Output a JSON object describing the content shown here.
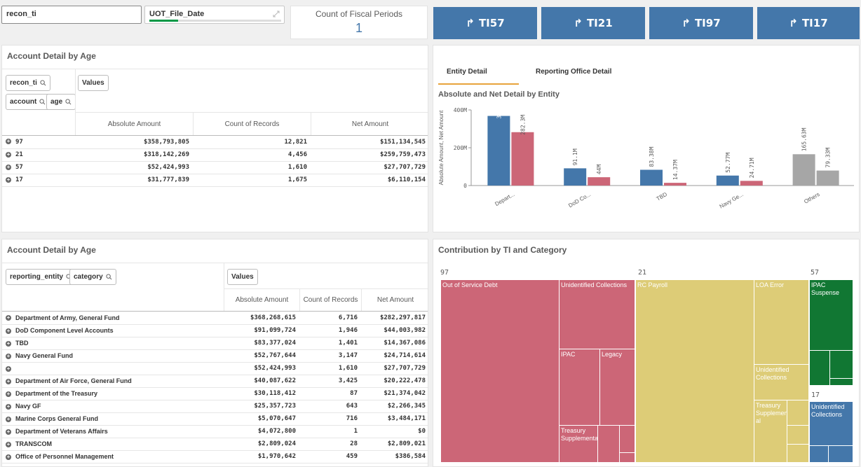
{
  "filters": {
    "recon_ti": "recon_ti",
    "uot_file_date": "UOT_File_Date"
  },
  "kpi": {
    "label": "Count of Fiscal Periods",
    "value": "1"
  },
  "ti_buttons": [
    {
      "label": "TI57"
    },
    {
      "label": "TI21"
    },
    {
      "label": "TI97"
    },
    {
      "label": "TI17"
    }
  ],
  "panel1": {
    "title": "Account Detail by Age",
    "pills": [
      "recon_ti",
      "account",
      "age"
    ],
    "values_pill": "Values",
    "columns": [
      "Absolute Amount",
      "Count of Records",
      "Net Amount"
    ],
    "rows": [
      {
        "label": "97",
        "abs": "$358,793,805",
        "count": "12,821",
        "net": "$151,134,545"
      },
      {
        "label": "21",
        "abs": "$318,142,269",
        "count": "4,456",
        "net": "$259,759,473"
      },
      {
        "label": "57",
        "abs": "$52,424,993",
        "count": "1,610",
        "net": "$27,707,729"
      },
      {
        "label": "17",
        "abs": "$31,777,839",
        "count": "1,675",
        "net": "$6,110,154"
      }
    ]
  },
  "panel2": {
    "tabs": [
      "Entity Detail",
      "Reporting Office Detail"
    ],
    "title": "Absolute and Net Detail by Entity"
  },
  "chart_data": {
    "type": "bar",
    "ylabel": "Absolute Amount, Net Amount",
    "yticks": [
      "400M",
      "200M",
      "0"
    ],
    "ylim": [
      0,
      400
    ],
    "categories": [
      "Depart...",
      "DoD Co...",
      "TBD",
      "Navy Ge...",
      "Others"
    ],
    "series": [
      {
        "values": [
          368.27,
          91.1,
          83.38,
          52.77,
          165.63
        ],
        "labels": [
          "368.27M",
          "91.1M",
          "83.38M",
          "52.77M",
          "165.63M"
        ]
      },
      {
        "values": [
          282.3,
          44,
          14.37,
          24.71,
          79.33
        ],
        "labels": [
          "282.3M",
          "44M",
          "14.37M",
          "24.71M",
          "79.33M"
        ]
      }
    ],
    "colors": {
      "abs": "#4477aa",
      "net": "#cc6677",
      "others_abs": "#a6a6a6",
      "others_net": "#a6a6a6"
    }
  },
  "panel3": {
    "title": "Account Detail by Age",
    "pills": [
      "reporting_entity",
      "category"
    ],
    "values_pill": "Values",
    "columns": [
      "Absolute Amount",
      "Count of Records",
      "Net Amount"
    ],
    "rows": [
      {
        "label": "Department of Army, General Fund",
        "abs": "$368,268,615",
        "count": "6,716",
        "net": "$282,297,817"
      },
      {
        "label": "DoD Component Level Accounts",
        "abs": "$91,099,724",
        "count": "1,946",
        "net": "$44,003,982"
      },
      {
        "label": "TBD",
        "abs": "$83,377,024",
        "count": "1,401",
        "net": "$14,367,086"
      },
      {
        "label": "Navy General Fund",
        "abs": "$52,767,644",
        "count": "3,147",
        "net": "$24,714,614"
      },
      {
        "label": "",
        "abs": "$52,424,993",
        "count": "1,610",
        "net": "$27,707,729"
      },
      {
        "label": "Department of Air Force, General Fund",
        "abs": "$40,087,622",
        "count": "3,425",
        "net": "$20,222,478"
      },
      {
        "label": "Department of the Treasury",
        "abs": "$30,118,412",
        "count": "87",
        "net": "$21,374,042"
      },
      {
        "label": "Navy GF",
        "abs": "$25,357,723",
        "count": "643",
        "net": "$2,266,345"
      },
      {
        "label": "Marine Corps General Fund",
        "abs": "$5,070,647",
        "count": "716",
        "net": "$3,484,171"
      },
      {
        "label": "Department of Veterans Affairs",
        "abs": "$4,072,800",
        "count": "1",
        "net": "$0"
      },
      {
        "label": "TRANSCOM",
        "abs": "$2,809,024",
        "count": "28",
        "net": "$2,809,021"
      },
      {
        "label": "Office of Personnel Management",
        "abs": "$1,970,642",
        "count": "459",
        "net": "$386,584"
      }
    ]
  },
  "panel4": {
    "title": "Contribution by TI and Category",
    "groups": [
      "97",
      "21",
      "57",
      "17"
    ],
    "cells": {
      "out_of_service": "Out of Service Debt",
      "unidentified_97": "Unidentified Collections",
      "ipac": "IPAC",
      "legacy": "Legacy",
      "treasury_97": "Treasury Supplemental",
      "rc_payroll": "RC Payroll",
      "loa_error": "LOA Error",
      "unidentified_21": "Unidentified Collections",
      "treasury_21": "Treasury Supplement-al",
      "ipac_suspense": "IPAC Suspense",
      "unidentified_17": "Unidentified Collections"
    },
    "colors": {
      "c97": "#cc6677",
      "c21": "#ddcc77",
      "c57": "#117733",
      "c17": "#4477aa"
    }
  }
}
